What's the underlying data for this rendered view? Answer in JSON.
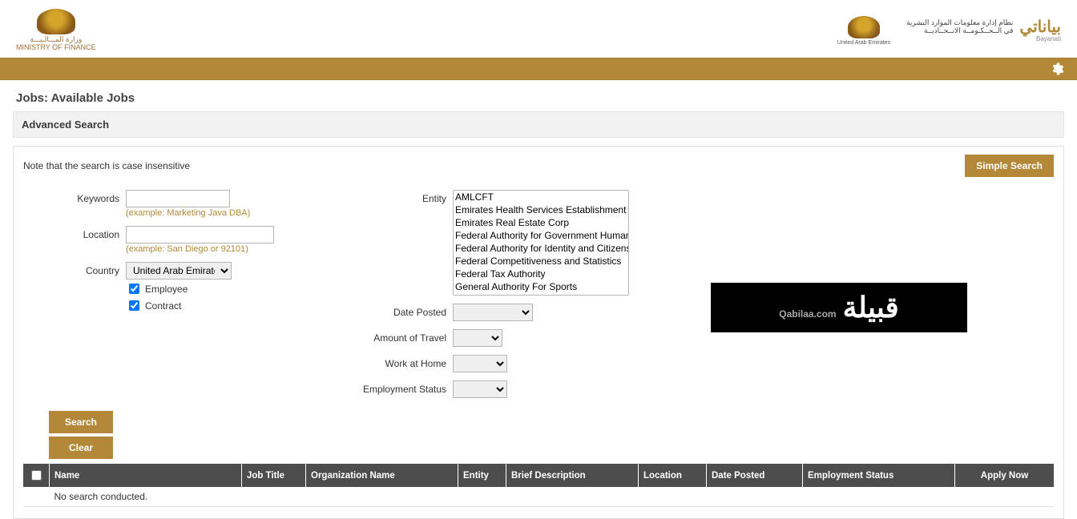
{
  "header": {
    "ministry_ar": "وزارة المـــالـيـــة",
    "ministry_en": "MINISTRY OF FINANCE",
    "bayanati_ar": "نظام إدارة معلومات الموارد البشرية",
    "bayanati_sub": "في الــحــكـومــة الاتــحــاديــة",
    "bayanati_logo": "بياناتي"
  },
  "page_title": "Jobs: Available Jobs",
  "section_title": "Advanced Search",
  "note_text": "Note that the search is case insensitive",
  "simple_search_label": "Simple Search",
  "labels": {
    "keywords": "Keywords",
    "location": "Location",
    "country": "Country",
    "employee": "Employee",
    "contract": "Contract",
    "entity": "Entity",
    "date_posted": "Date Posted",
    "amount_of_travel": "Amount of Travel",
    "work_at_home": "Work at Home",
    "employment_status": "Employment Status"
  },
  "hints": {
    "keywords": "(example: Marketing Java DBA)",
    "location": "(example: San Diego or 92101)"
  },
  "country_value": "United Arab Emirates",
  "checkbox_values": {
    "employee": true,
    "contract": true
  },
  "entity_options": [
    "AMLCFT",
    "Emirates Health Services Establishment",
    "Emirates Real Estate Corp",
    "Federal Authority for Government Human Resources",
    "Federal Authority for Identity and Citizenship",
    "Federal Competitiveness and Statistics",
    "Federal Tax Authority",
    "General Authority For Sports"
  ],
  "buttons": {
    "search": "Search",
    "clear": "Clear"
  },
  "table": {
    "headers": {
      "name": "Name",
      "job_title": "Job Title",
      "org_name": "Organization Name",
      "entity": "Entity",
      "brief_desc": "Brief Description",
      "location": "Location",
      "date_posted": "Date Posted",
      "emp_status": "Employment Status",
      "apply_now": "Apply Now"
    },
    "no_results": "No search conducted."
  },
  "watermark": {
    "ar": "قبيلة",
    "lat": "Qabilaa.com"
  }
}
